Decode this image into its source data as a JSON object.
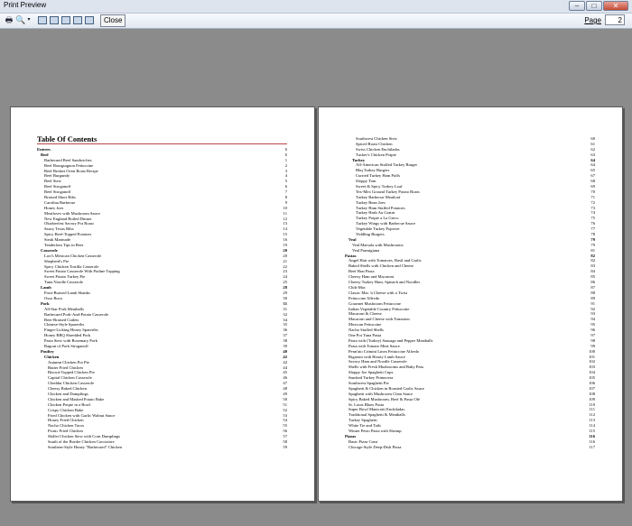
{
  "window": {
    "title": "Print Preview",
    "minimize": "–",
    "maximize": "□",
    "close": "✕"
  },
  "toolbar": {
    "close_label": "Close",
    "page_label": "Page",
    "page_value": "2"
  },
  "page1": {
    "heading": "Table Of Contents",
    "entries": [
      {
        "t": "Entrees",
        "n": "1",
        "lvl": 0,
        "b": true
      },
      {
        "t": "Beef",
        "n": "1",
        "lvl": 1,
        "b": true
      },
      {
        "t": "Barbecued Beef Sandwiches",
        "n": "1",
        "lvl": 2
      },
      {
        "t": "Beef Bourguignon Fettuccine",
        "n": "2",
        "lvl": 2
      },
      {
        "t": "Beef Brisket Oven Roast Recipe",
        "n": "3",
        "lvl": 2
      },
      {
        "t": "Beef Burgundy",
        "n": "4",
        "lvl": 2
      },
      {
        "t": "Beef Stew",
        "n": "5",
        "lvl": 2
      },
      {
        "t": "Beef Stroganoff",
        "n": "6",
        "lvl": 2
      },
      {
        "t": "Beef Stroganoff",
        "n": "7",
        "lvl": 2
      },
      {
        "t": "Braised Short Ribs",
        "n": "8",
        "lvl": 2
      },
      {
        "t": "Carolina Barbecue",
        "n": "9",
        "lvl": 2
      },
      {
        "t": "Honey Joes",
        "n": "10",
        "lvl": 2
      },
      {
        "t": "Meatloves with Mushroom Sauce",
        "n": "11",
        "lvl": 2
      },
      {
        "t": "New England Boiled Dinner",
        "n": "12",
        "lvl": 2
      },
      {
        "t": "Oktoberfest Savory Pot Roast",
        "n": "13",
        "lvl": 2
      },
      {
        "t": "Saucy Texas Ribs",
        "n": "14",
        "lvl": 2
      },
      {
        "t": "Spicy Beef-Topped Potatoes",
        "n": "15",
        "lvl": 2
      },
      {
        "t": "Steak Marinade",
        "n": "16",
        "lvl": 2
      },
      {
        "t": "Tenderloin Tips in Beer",
        "n": "19",
        "lvl": 2
      },
      {
        "t": "Casserole",
        "n": "20",
        "lvl": 1,
        "b": true
      },
      {
        "t": "Lori's Mexican Chicken Casserole",
        "n": "20",
        "lvl": 2
      },
      {
        "t": "Shepherd's Pie",
        "n": "21",
        "lvl": 2
      },
      {
        "t": "Spicy Chicken Tortilla Casserole",
        "n": "22",
        "lvl": 2
      },
      {
        "t": "Sweet Potato Casserole With Praline Topping",
        "n": "23",
        "lvl": 2
      },
      {
        "t": "Sweet Potato Turkey Pie",
        "n": "24",
        "lvl": 2
      },
      {
        "t": "Tuna Noodle Casserole",
        "n": "25",
        "lvl": 2
      },
      {
        "t": "Lamb",
        "n": "28",
        "lvl": 1,
        "b": true
      },
      {
        "t": "Fruit-Braised Lamb Shanks",
        "n": "29",
        "lvl": 2
      },
      {
        "t": "Osso Buco",
        "n": "30",
        "lvl": 2
      },
      {
        "t": "Pork",
        "n": "31",
        "lvl": 1,
        "b": true
      },
      {
        "t": "All-Star Pork Meatballs",
        "n": "31",
        "lvl": 2
      },
      {
        "t": "Barbecued Pork-And-Potato Casserole",
        "n": "32",
        "lvl": 2
      },
      {
        "t": "Beer-Braised Cutlets",
        "n": "34",
        "lvl": 2
      },
      {
        "t": "Chinese-Style Spareribs",
        "n": "35",
        "lvl": 2
      },
      {
        "t": "Finger-Licking Honey Spareribs",
        "n": "36",
        "lvl": 2
      },
      {
        "t": "Honey BBQ Shredded Pork",
        "n": "37",
        "lvl": 2
      },
      {
        "t": "Pasta Stew with Rosemary Pork",
        "n": "38",
        "lvl": 2
      },
      {
        "t": "Ragout of Pork Stroganoff",
        "n": "39",
        "lvl": 2
      },
      {
        "t": "Poultry",
        "n": "40",
        "lvl": 1,
        "b": true
      },
      {
        "t": "Chicken",
        "n": "42",
        "lvl": 2,
        "b": true
      },
      {
        "t": "Autumn Chicken Pot Pie",
        "n": "42",
        "lvl": 3
      },
      {
        "t": "Butter Fried Chicken",
        "n": "44",
        "lvl": 3
      },
      {
        "t": "Biscuit-Topped Chicken Pie",
        "n": "45",
        "lvl": 3
      },
      {
        "t": "Capital Chicken Casserole",
        "n": "46",
        "lvl": 3
      },
      {
        "t": "Cheddar Chicken Casserole",
        "n": "47",
        "lvl": 3
      },
      {
        "t": "Cheesy Baked Chicken",
        "n": "48",
        "lvl": 3
      },
      {
        "t": "Chicken and Dumplings",
        "n": "49",
        "lvl": 3
      },
      {
        "t": "Chicken and Mashed Potato Bake",
        "n": "50",
        "lvl": 3
      },
      {
        "t": "Chicken Potpie in a Bowl",
        "n": "51",
        "lvl": 3
      },
      {
        "t": "Crispy Chicken Bake",
        "n": "52",
        "lvl": 3
      },
      {
        "t": "Fried Chicken with Garlic Walnut Sauce",
        "n": "53",
        "lvl": 3
      },
      {
        "t": "Honey Fried Chicken",
        "n": "54",
        "lvl": 3
      },
      {
        "t": "Nacho Chicken Tacos",
        "n": "55",
        "lvl": 3
      },
      {
        "t": "Picnic Fried Chicken",
        "n": "56",
        "lvl": 3
      },
      {
        "t": "Skillet Chicken Stew with Corn Dumplings",
        "n": "57",
        "lvl": 3
      },
      {
        "t": "South of the Border Chicken Cacciatore",
        "n": "58",
        "lvl": 3
      },
      {
        "t": "Southern-Style Honey \"Barbecued\" Chicken",
        "n": "59",
        "lvl": 3
      }
    ]
  },
  "page2": {
    "entries": [
      {
        "t": "Southwest Chicken Stew",
        "n": "60",
        "lvl": 3
      },
      {
        "t": "Spiced Roast Chicken",
        "n": "61",
        "lvl": 3
      },
      {
        "t": "Swiss Chicken Enchiladas",
        "n": "62",
        "lvl": 3
      },
      {
        "t": "Tucker's Chicken Potpie",
        "n": "63",
        "lvl": 3
      },
      {
        "t": "Turkey",
        "n": "64",
        "lvl": 2,
        "b": true
      },
      {
        "t": "All-American Stuffed Turkey Burger",
        "n": "64",
        "lvl": 3
      },
      {
        "t": "Bbq Turkey Burgers",
        "n": "65",
        "lvl": 3
      },
      {
        "t": "Curried Turkey Ham Puffs",
        "n": "67",
        "lvl": 3
      },
      {
        "t": "Sloppy Tom",
        "n": "68",
        "lvl": 3
      },
      {
        "t": "Sweet & Spicy Turkey Loaf",
        "n": "69",
        "lvl": 3
      },
      {
        "t": "Tex-Mex Ground Turkey Potato Boats",
        "n": "70",
        "lvl": 3
      },
      {
        "t": "Turkey Barbecue Meatloaf",
        "n": "71",
        "lvl": 3
      },
      {
        "t": "Turkey Bean Joes",
        "n": "72",
        "lvl": 3
      },
      {
        "t": "Turkey Ham Stuffed Potatoes",
        "n": "73",
        "lvl": 3
      },
      {
        "t": "Turkey Hash Au Gratin",
        "n": "74",
        "lvl": 3
      },
      {
        "t": "Turkey Potpie a La Greco",
        "n": "75",
        "lvl": 3
      },
      {
        "t": "Turkey Wings with Barbecue Sauce",
        "n": "76",
        "lvl": 3
      },
      {
        "t": "Vegetable Turkey Popover",
        "n": "77",
        "lvl": 3
      },
      {
        "t": "Yiddling Burgers",
        "n": "78",
        "lvl": 3
      },
      {
        "t": "Veal",
        "n": "79",
        "lvl": 1,
        "b": true
      },
      {
        "t": "Veal Marsala with Mushrooms",
        "n": "79",
        "lvl": 2
      },
      {
        "t": "Veal Parmigiana",
        "n": "81",
        "lvl": 2
      },
      {
        "t": "Pastas",
        "n": "82",
        "lvl": 0,
        "b": true
      },
      {
        "t": "Angel Hair with Tomatoes, Basil and Garlic",
        "n": "82",
        "lvl": 1
      },
      {
        "t": "Baked Shells with Chicken and Cheese",
        "n": "83",
        "lvl": 1
      },
      {
        "t": "Beef Brat Pasta",
        "n": "84",
        "lvl": 1
      },
      {
        "t": "Cheesy Ham and Macaroni",
        "n": "85",
        "lvl": 1
      },
      {
        "t": "Cheesy Turkey Ham, Spinach and Noodles",
        "n": "86",
        "lvl": 1
      },
      {
        "t": "Chili-Mac",
        "n": "87",
        "lvl": 1
      },
      {
        "t": "Classic Mac 'n Cheese with a Twist",
        "n": "88",
        "lvl": 1
      },
      {
        "t": "Fettuccine Alfredo",
        "n": "89",
        "lvl": 1
      },
      {
        "t": "Gourmet Mushroom Fettuccine",
        "n": "91",
        "lvl": 1
      },
      {
        "t": "Italian Vegetable Country Fettuccine",
        "n": "92",
        "lvl": 1
      },
      {
        "t": "Macaroni & Cheese",
        "n": "93",
        "lvl": 1
      },
      {
        "t": "Macaroni and Cheese with Tomatoes",
        "n": "94",
        "lvl": 1
      },
      {
        "t": "Mexican Fettuccine",
        "n": "95",
        "lvl": 1
      },
      {
        "t": "Nacho Stuffed Shells",
        "n": "96",
        "lvl": 1
      },
      {
        "t": "One Pot Tuna Pasta",
        "n": "97",
        "lvl": 1
      },
      {
        "t": "Pasta with (Turkey) Sausage and Pepper Meatballs",
        "n": "98",
        "lvl": 1
      },
      {
        "t": "Pasta with Tomato Meat Sauce",
        "n": "99",
        "lvl": 1
      },
      {
        "t": "Penn'ato Crimini Linea Fettuccine Alfredo",
        "n": "100",
        "lvl": 1
      },
      {
        "t": "Rigatoni with Hearty Lamb Sauce",
        "n": "101",
        "lvl": 1
      },
      {
        "t": "Savory Ham and Noodle Casserole",
        "n": "102",
        "lvl": 1
      },
      {
        "t": "Shells with Fresh Mushrooms and Baby Peas",
        "n": "103",
        "lvl": 1
      },
      {
        "t": "Sloppy Joe Spaghetti Cups",
        "n": "104",
        "lvl": 1
      },
      {
        "t": "Smoked Turkey Primavera",
        "n": "105",
        "lvl": 1
      },
      {
        "t": "Southwest Spaghetti Pie",
        "n": "106",
        "lvl": 1
      },
      {
        "t": "Spaghetti & Chicken in Roasted Garlic Sauce",
        "n": "107",
        "lvl": 1
      },
      {
        "t": "Spaghetti with Mushroom Clam Sauce",
        "n": "108",
        "lvl": 1
      },
      {
        "t": "Spicy Baked Mushroom, Beef & Pasta Olé",
        "n": "109",
        "lvl": 1
      },
      {
        "t": "St. Louis Blues Pasta",
        "n": "110",
        "lvl": 1
      },
      {
        "t": "Super Bowl Manicotti Enchiladas",
        "n": "111",
        "lvl": 1
      },
      {
        "t": "Traditional Spaghetti & Meatballs",
        "n": "112",
        "lvl": 1
      },
      {
        "t": "Turkey Spaghetti",
        "n": "113",
        "lvl": 1
      },
      {
        "t": "White Tie and Tails",
        "n": "114",
        "lvl": 1
      },
      {
        "t": "Winter Pesto Pasta with Shrimp",
        "n": "115",
        "lvl": 1
      },
      {
        "t": "Pizzas",
        "n": "116",
        "lvl": 0,
        "b": true
      },
      {
        "t": "Basic Pizza Crust",
        "n": "116",
        "lvl": 1
      },
      {
        "t": "Chicago-Style Deep-Dish Pizza",
        "n": "117",
        "lvl": 1
      }
    ]
  }
}
